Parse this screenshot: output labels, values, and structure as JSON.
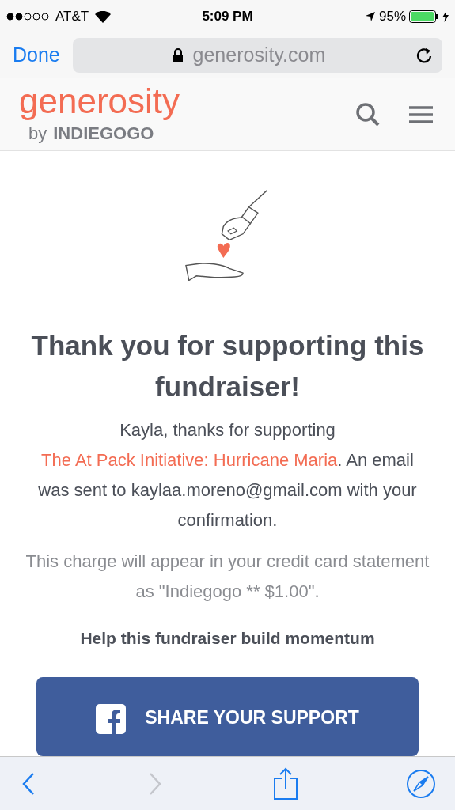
{
  "status_bar": {
    "carrier": "AT&T",
    "time": "5:09 PM",
    "battery": "95%"
  },
  "browser": {
    "done": "Done",
    "url": "generosity.com"
  },
  "header": {
    "logo": "generosity",
    "byline_prefix": "by",
    "byline_brand": "INDIEGOGO"
  },
  "content": {
    "title": "Thank you for supporting this fundraiser!",
    "message": {
      "before": "Kayla, thanks for supporting ",
      "link": "The At Pack Initiative: Hurricane Maria",
      "after": ". An email was sent to kaylaa.moreno@gmail.com with your confirmation."
    },
    "charge_note": "This charge will appear in your credit card statement as \"Indiegogo ** $1.00\".",
    "momentum": "Help this fundraiser build momentum",
    "share_button": "SHARE YOUR SUPPORT"
  },
  "toolbar": [
    {
      "kind": "back",
      "disabled": false
    },
    {
      "kind": "forward",
      "disabled": true
    },
    {
      "kind": "share",
      "disabled": false
    },
    {
      "kind": "compass",
      "disabled": false
    }
  ]
}
